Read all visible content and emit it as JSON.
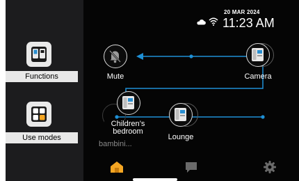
{
  "status": {
    "date": "20 MAR 2024",
    "time": "11:23 AM",
    "cloud_icon": "cloud-icon",
    "wifi_icon": "wifi-icon"
  },
  "sidebar": {
    "items": [
      {
        "label": "Functions",
        "icon": "functions-icon"
      },
      {
        "label": "Use modes",
        "icon": "use-modes-icon"
      }
    ]
  },
  "devices": [
    {
      "label": "Mute",
      "icon": "bell-off-icon"
    },
    {
      "label": "Camera",
      "icon": "intercom-icon"
    },
    {
      "label": "Children’s bedroom",
      "icon": "intercom-icon"
    },
    {
      "label": "Lounge",
      "icon": "intercom-icon"
    },
    {
      "label": "bambini...",
      "icon": "intercom-icon"
    }
  ],
  "navbar": {
    "items": [
      {
        "name": "home",
        "icon": "home-icon",
        "active": true
      },
      {
        "name": "messages",
        "icon": "chat-icon",
        "active": false
      },
      {
        "name": "settings",
        "icon": "gear-icon",
        "active": false
      }
    ]
  },
  "colors": {
    "accent": "#f5a623",
    "link_line": "#1e90d6",
    "sidebar_bg": "#1c1c1e",
    "screen_bg": "#050505"
  }
}
